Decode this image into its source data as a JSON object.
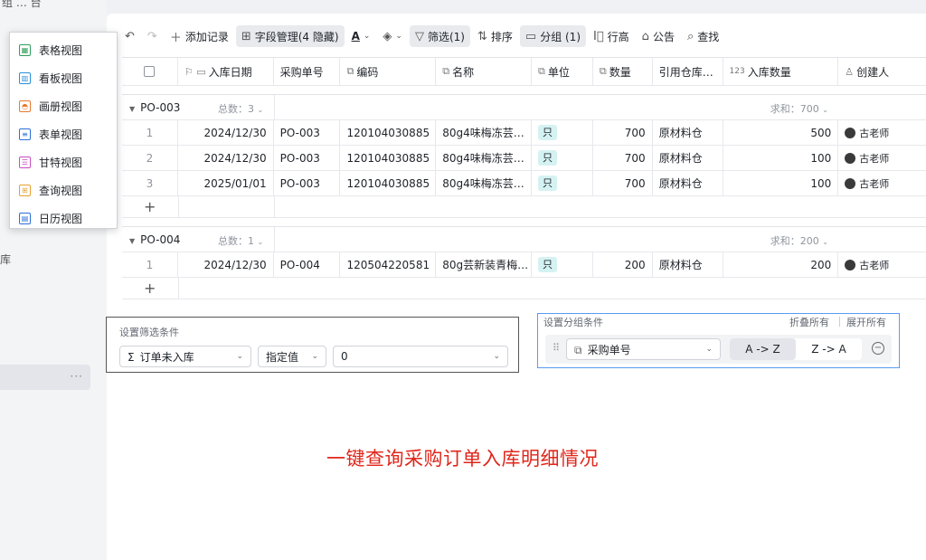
{
  "sidebar": {
    "top_fragment": "组 … 台",
    "partial_label": "库",
    "more_dots": "···"
  },
  "view_menu": {
    "items": [
      {
        "label": "表格视图",
        "icon": "grid-icon",
        "color": "#2e9e5b"
      },
      {
        "label": "看板视图",
        "icon": "kanban-icon",
        "color": "#2b8fd9"
      },
      {
        "label": "画册视图",
        "icon": "gallery-icon",
        "color": "#e57a2e"
      },
      {
        "label": "表单视图",
        "icon": "form-icon",
        "color": "#2b6fd9"
      },
      {
        "label": "甘特视图",
        "icon": "gantt-icon",
        "color": "#c84cc1"
      },
      {
        "label": "查询视图",
        "icon": "query-icon",
        "color": "#e5a12e"
      },
      {
        "label": "日历视图",
        "icon": "calendar-icon",
        "color": "#2b6fd9"
      }
    ]
  },
  "toolbar": {
    "undo": "↶",
    "redo": "↷",
    "add_record": "添加记录",
    "field_mgmt": "字段管理(4 隐藏)",
    "text_color": "A",
    "fill": "◈",
    "filter": "筛选(1)",
    "sort": "排序",
    "group": "分组 (1)",
    "row_height": "行高",
    "notice": "公告",
    "find": "查找"
  },
  "table": {
    "headers": [
      "入库日期",
      "采购单号",
      "编码",
      "名称",
      "单位",
      "数量",
      "引用仓库…",
      "入库数量",
      "创建人"
    ],
    "header_icons": [
      "⚐ ▭",
      "",
      "⧉",
      "⧉",
      "⧉",
      "⧉",
      "",
      "123",
      "♙"
    ],
    "groups": [
      {
        "name": "PO-003",
        "count": "总数：3",
        "sum": "求和：700",
        "rows": [
          {
            "idx": "1",
            "date": "2024/12/30",
            "po": "PO-003",
            "code": "120104030885",
            "name": "80g4味梅冻芸…",
            "unit": "只",
            "qty": "700",
            "warehouse": "原材料仓",
            "in_qty": "500",
            "creator": "古老师"
          },
          {
            "idx": "2",
            "date": "2024/12/30",
            "po": "PO-003",
            "code": "120104030885",
            "name": "80g4味梅冻芸…",
            "unit": "只",
            "qty": "700",
            "warehouse": "原材料仓",
            "in_qty": "100",
            "creator": "古老师"
          },
          {
            "idx": "3",
            "date": "2025/01/01",
            "po": "PO-003",
            "code": "120104030885",
            "name": "80g4味梅冻芸…",
            "unit": "只",
            "qty": "700",
            "warehouse": "原材料仓",
            "in_qty": "100",
            "creator": "古老师"
          }
        ]
      },
      {
        "name": "PO-004",
        "count": "总数：1",
        "sum": "求和：200",
        "rows": [
          {
            "idx": "1",
            "date": "2024/12/30",
            "po": "PO-004",
            "code": "120504220581",
            "name": "80g芸新装青梅…",
            "unit": "只",
            "qty": "200",
            "warehouse": "原材料仓",
            "in_qty": "200",
            "creator": "古老师"
          }
        ]
      }
    ],
    "add_symbol": "+"
  },
  "filter_panel": {
    "title": "设置筛选条件",
    "field": "订单未入库",
    "operator": "指定值",
    "value": "0"
  },
  "group_panel": {
    "title": "设置分组条件",
    "collapse_all": "折叠所有",
    "expand_all": "展开所有",
    "field": "采购单号",
    "sort_asc": "A -> Z",
    "sort_desc": "Z -> A"
  },
  "caption": "一键查询采购订单入库明细情况"
}
